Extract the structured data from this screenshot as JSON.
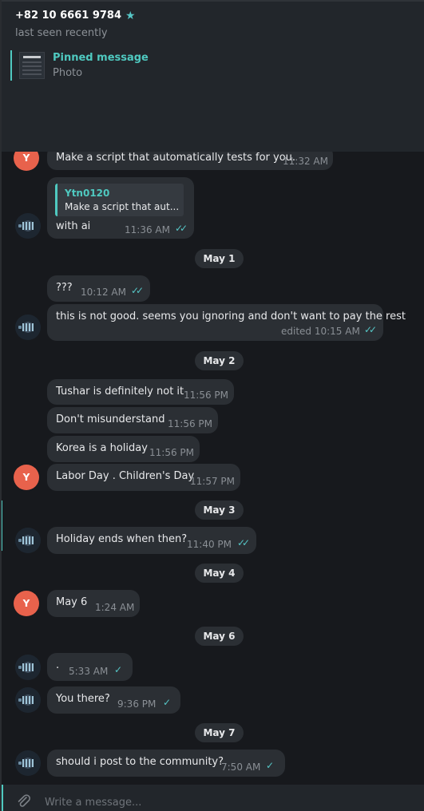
{
  "header": {
    "contact_name": "+82 10 6661 9784",
    "status": "last seen recently",
    "pinned_title": "Pinned message",
    "pinned_sub": "Photo"
  },
  "chat": {
    "msg1": {
      "text": "Make a script that automatically tests for you.",
      "time": "11:32 AM",
      "avatar": "Y"
    },
    "msg2": {
      "reply_author": "Ytn0120",
      "reply_text": "Make a script that aut...",
      "text": "with ai",
      "time": "11:36 AM"
    },
    "date_may1": "May 1",
    "msg3": {
      "text": "???",
      "time": "10:12 AM"
    },
    "msg4": {
      "text": "this is not good. seems you ignoring and don't want to pay the rest",
      "time": "edited 10:15 AM"
    },
    "date_may2": "May 2",
    "msg5": {
      "text": "Tushar is definitely not it",
      "time": "11:56 PM"
    },
    "msg6": {
      "text": "Don't misunderstand",
      "time": "11:56 PM"
    },
    "msg7": {
      "text": "Korea is a holiday",
      "time": "11:56 PM"
    },
    "msg8": {
      "text": "Labor Day . Children's Day",
      "time": "11:57 PM",
      "avatar": "Y"
    },
    "date_may3": "May 3",
    "msg9": {
      "text": "Holiday ends when then?",
      "time": "11:40 PM"
    },
    "date_may4": "May 4",
    "msg10": {
      "text": "May 6",
      "time": "1:24 AM",
      "avatar": "Y"
    },
    "date_may6": "May 6",
    "msg11": {
      "text": ".",
      "time": "5:33 AM"
    },
    "msg12": {
      "text": "You there?",
      "time": "9:36 PM"
    },
    "date_may7": "May 7",
    "msg13": {
      "text": "should i post to the community?",
      "time": "7:50 AM"
    }
  },
  "composer": {
    "placeholder": "Write a message..."
  },
  "colors": {
    "accent": "#4fc9c0",
    "avatar_y": "#e8624c",
    "bubble": "#2b2f34",
    "background": "#17191d"
  }
}
